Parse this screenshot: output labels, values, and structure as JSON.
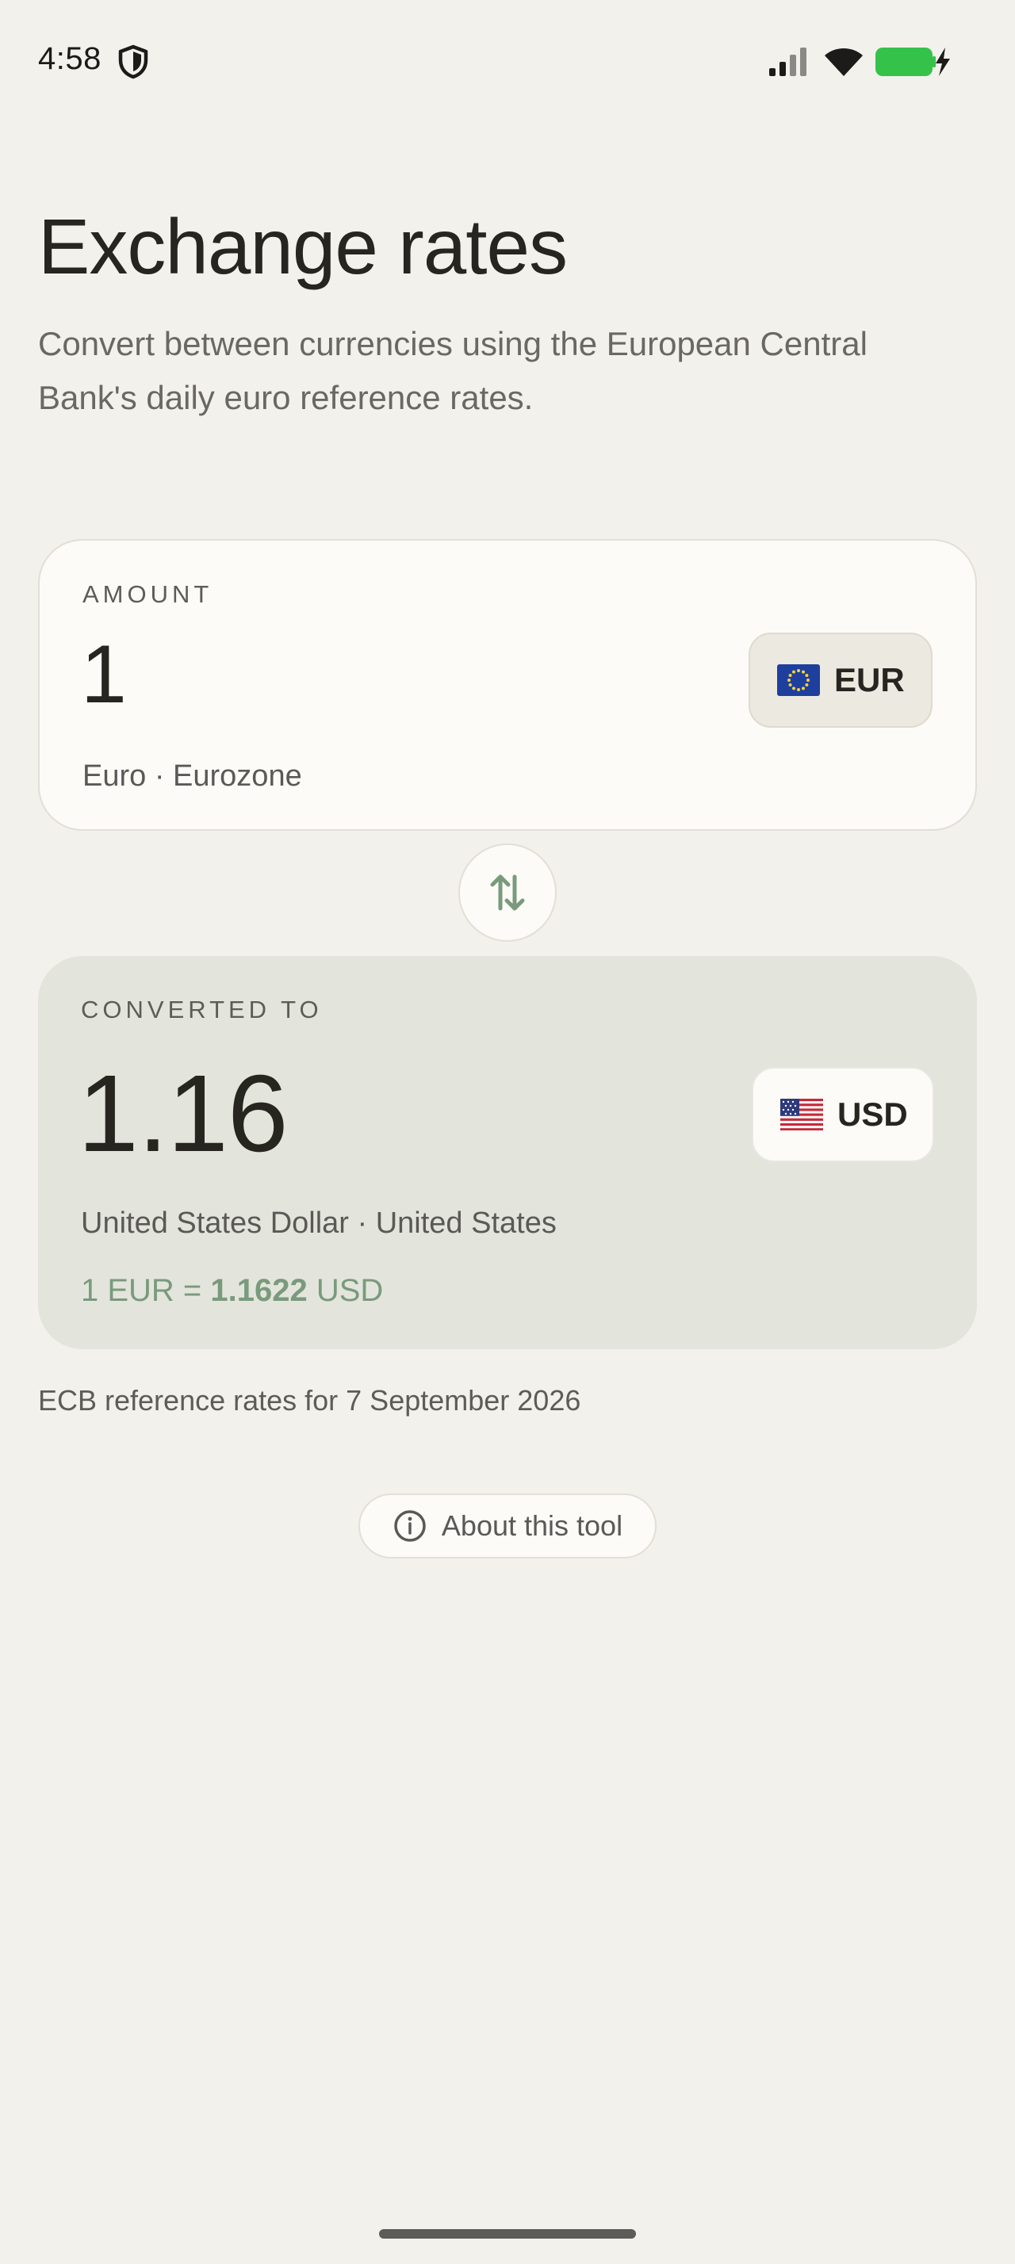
{
  "status_bar": {
    "time": "4:58"
  },
  "header": {
    "title": "Exchange rates",
    "subtitle": "Convert between currencies using the European Central Bank's daily euro reference rates."
  },
  "amount_card": {
    "label": "AMOUNT",
    "value": "1",
    "currency_code": "EUR",
    "description": "Euro · Eurozone"
  },
  "result_card": {
    "label": "CONVERTED TO",
    "value": "1.16",
    "currency_code": "USD",
    "description": "United States Dollar · United States",
    "rate_prefix": "1 EUR = ",
    "rate_value": "1.1622",
    "rate_suffix": " USD"
  },
  "footer": {
    "note": "ECB reference rates for 7 September 2026",
    "about_label": "About this tool"
  },
  "icons": {
    "shield": "shield-icon",
    "signal": "signal-icon",
    "wifi": "wifi-icon",
    "battery": "battery-charging-icon",
    "swap": "swap-vertical-icon",
    "info": "info-icon",
    "eur_flag": "eu-flag-icon",
    "usd_flag": "us-flag-icon"
  },
  "colors": {
    "background": "#f3f1eb",
    "accent": "#7a9a7c",
    "battery": "#35c24a"
  }
}
